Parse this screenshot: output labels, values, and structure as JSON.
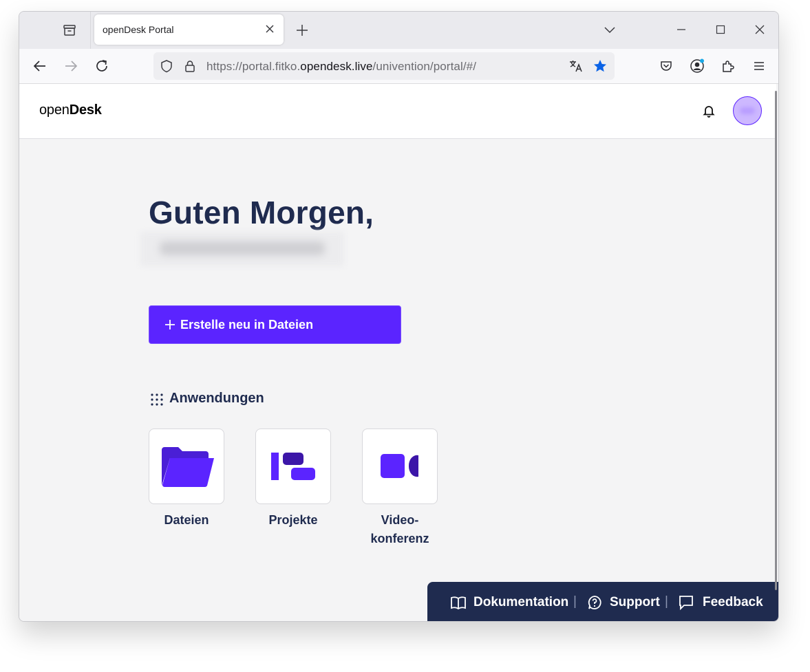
{
  "browser": {
    "tab_title": "openDesk Portal",
    "url_prefix": "https://portal.fitko.",
    "url_host": "opendesk.live",
    "url_path": "/univention/portal/#/"
  },
  "header": {
    "logo_light": "open",
    "logo_bold": "Desk"
  },
  "main": {
    "greeting": "Guten Morgen,",
    "create_button_label": "Erstelle neu in Dateien",
    "apps_heading": "Anwendungen",
    "apps": [
      {
        "label": "Dateien",
        "icon": "folder-icon"
      },
      {
        "label": "Projekte",
        "icon": "projects-icon"
      },
      {
        "label_line1": "Video-",
        "label_line2": "konferenz",
        "icon": "video-camera-icon"
      }
    ]
  },
  "footer": {
    "documentation": "Dokumentation",
    "support": "Support",
    "feedback": "Feedback",
    "separator": "|"
  },
  "colors": {
    "brand": "#5b24ff",
    "navy": "#1f2b4f",
    "page_bg": "#f4f4f5"
  }
}
